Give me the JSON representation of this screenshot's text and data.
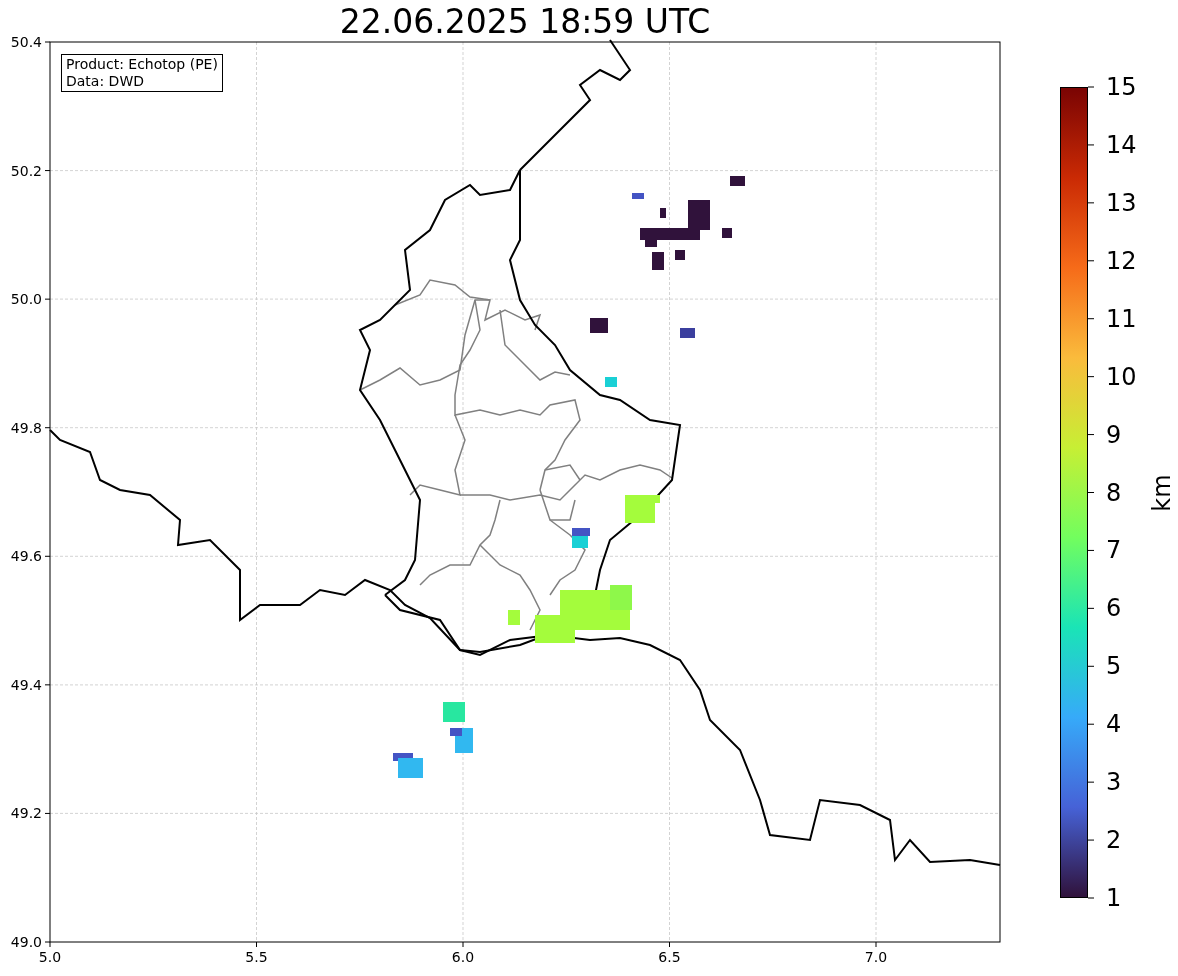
{
  "title": "22.06.2025 18:59 UTC",
  "info_box": {
    "lines": [
      "Product: Echotop (PE)",
      "Data: DWD"
    ]
  },
  "x_axis": {
    "ticks": [
      "5.0",
      "5.5",
      "6.0",
      "6.5",
      "7.0"
    ]
  },
  "y_axis": {
    "ticks": [
      "50.4",
      "50.2",
      "50.0",
      "49.8",
      "49.6",
      "49.4",
      "49.2",
      "49.0"
    ]
  },
  "colorbar": {
    "label": "km",
    "ticks": [
      "15",
      "14",
      "13",
      "12",
      "11",
      "10",
      "9",
      "8",
      "7",
      "6",
      "5",
      "4",
      "3",
      "2",
      "1"
    ]
  }
}
